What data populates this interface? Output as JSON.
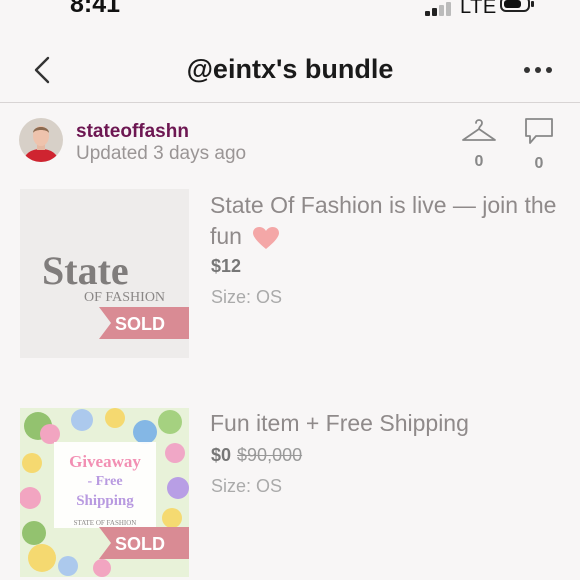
{
  "status_bar": {
    "time": "8:41",
    "carrier": "LTE"
  },
  "nav": {
    "title": "@eintx's bundle",
    "back_icon": "chevron-left-icon",
    "more_icon": "ellipsis-icon"
  },
  "seller": {
    "username": "stateoffashn",
    "updated": "Updated 3 days ago",
    "likes": "0",
    "comments": "0"
  },
  "listings": [
    {
      "title": "State Of Fashion is live — join the fun",
      "price": "$12",
      "size": "Size: OS",
      "badge": "SOLD",
      "logo_main": "State",
      "logo_sub": "OF FASHION"
    },
    {
      "title": "Fun item + Free Shipping",
      "price": "$0",
      "original_price": "$90,000",
      "size": "Size: OS",
      "badge": "SOLD",
      "img_line1": "Giveaway",
      "img_line2": "- Free",
      "img_line3": "Shipping",
      "img_footer": "STATE OF FASHION"
    }
  ],
  "colors": {
    "seller_name": "#6d1752",
    "sold_badge": "#d98b94",
    "heart": "#f4a7a7"
  }
}
